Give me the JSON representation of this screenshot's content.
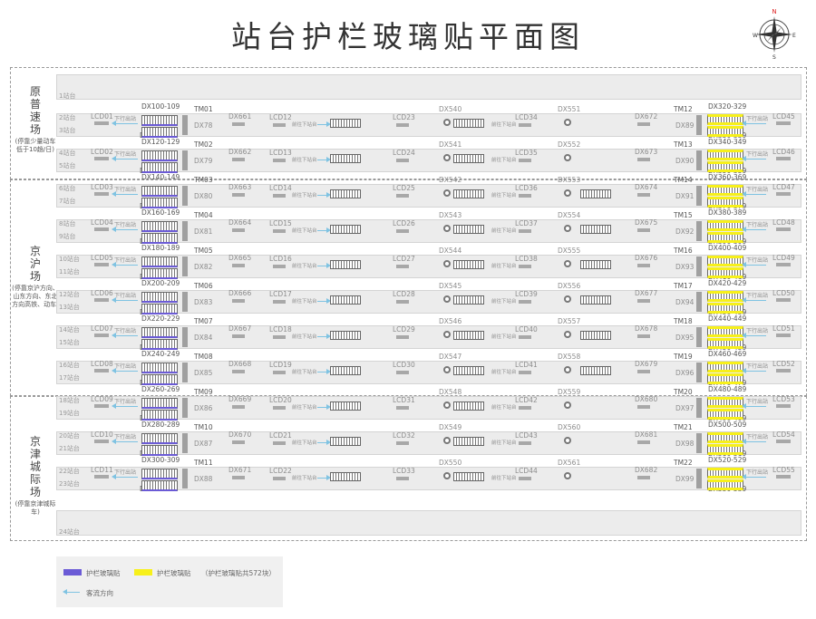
{
  "title": "站台护栏玻璃贴平面图",
  "compass_label": "N",
  "zones": [
    {
      "name": "原普速场",
      "note": "(停靠少量动车低于10趟/日)"
    },
    {
      "name": "京沪场",
      "note": "(停靠京沪方向、山东方向、东北方向高铁、动车)"
    },
    {
      "name": "京津城际场",
      "note": "(停靠京津城际车)"
    }
  ],
  "stations": [
    {
      "top": "1站台",
      "bottom": ""
    },
    {
      "top": "2站台",
      "bottom": "3站台",
      "left_dx_top": "DX100-109",
      "left_dx_bottom": "DX110-119",
      "tm_left": "TM01",
      "dx_l": "DX78",
      "dx_ml": "DX661",
      "lcd_l": "LCD01",
      "lcd_ml": "LCD12",
      "lcd_c": "LCD23",
      "dx_c": "DX540",
      "lcd_cr": "LCD34",
      "dx_cr": "DX551",
      "dx_mr": "DX672",
      "tm_right": "TM12",
      "dx_r": "DX89",
      "right_dx_top": "DX320-329",
      "right_dx_bottom": "DX330-339",
      "lcd_r": "LCD45"
    },
    {
      "top": "4站台",
      "bottom": "5站台",
      "left_dx_top": "DX120-129",
      "left_dx_bottom": "DX130-139",
      "tm_left": "TM02",
      "dx_l": "DX79",
      "dx_ml": "DX662",
      "lcd_l": "LCD02",
      "lcd_ml": "LCD13",
      "lcd_c": "LCD24",
      "dx_c": "DX541",
      "lcd_cr": "LCD35",
      "dx_cr": "DX552",
      "dx_mr": "DX673",
      "tm_right": "TM13",
      "dx_r": "DX90",
      "right_dx_top": "DX340-349",
      "right_dx_bottom": "DX350-359",
      "lcd_r": "LCD46"
    },
    {
      "top": "6站台",
      "bottom": "7站台",
      "left_dx_top": "DX140-149",
      "left_dx_bottom": "DX150-159",
      "tm_left": "TM03",
      "dx_l": "DX80",
      "dx_ml": "DX663",
      "lcd_l": "LCD03",
      "lcd_ml": "LCD14",
      "lcd_c": "LCD25",
      "dx_c": "DX542",
      "lcd_cr": "LCD36",
      "dx_cr": "DX553",
      "dx_mr": "DX674",
      "tm_right": "TM14",
      "dx_r": "DX91",
      "right_dx_top": "DX360-369",
      "right_dx_bottom": "DX370-379",
      "lcd_r": "LCD47"
    },
    {
      "top": "8站台",
      "bottom": "9站台",
      "left_dx_top": "DX160-169",
      "left_dx_bottom": "DX170-179",
      "tm_left": "TM04",
      "dx_l": "DX81",
      "dx_ml": "DX664",
      "lcd_l": "LCD04",
      "lcd_ml": "LCD15",
      "lcd_c": "LCD26",
      "dx_c": "DX543",
      "lcd_cr": "LCD37",
      "dx_cr": "DX554",
      "dx_mr": "DX675",
      "tm_right": "TM15",
      "dx_r": "DX92",
      "right_dx_top": "DX380-389",
      "right_dx_bottom": "DX390-399",
      "lcd_r": "LCD48"
    },
    {
      "top": "10站台",
      "bottom": "11站台",
      "left_dx_top": "DX180-189",
      "left_dx_bottom": "DX190-199",
      "tm_left": "TM05",
      "dx_l": "DX82",
      "dx_ml": "DX665",
      "lcd_l": "LCD05",
      "lcd_ml": "LCD16",
      "lcd_c": "LCD27",
      "dx_c": "DX544",
      "lcd_cr": "LCD38",
      "dx_cr": "DX555",
      "dx_mr": "DX676",
      "tm_right": "TM16",
      "dx_r": "DX93",
      "right_dx_top": "DX400-409",
      "right_dx_bottom": "DX410-419",
      "lcd_r": "LCD49"
    },
    {
      "top": "12站台",
      "bottom": "13站台",
      "left_dx_top": "DX200-209",
      "left_dx_bottom": "DX210-219",
      "tm_left": "TM06",
      "dx_l": "DX83",
      "dx_ml": "DX666",
      "lcd_l": "LCD06",
      "lcd_ml": "LCD17",
      "lcd_c": "LCD28",
      "dx_c": "DX545",
      "lcd_cr": "LCD39",
      "dx_cr": "DX556",
      "dx_mr": "DX677",
      "tm_right": "TM17",
      "dx_r": "DX94",
      "right_dx_top": "DX420-429",
      "right_dx_bottom": "DX430-439",
      "lcd_r": "LCD50"
    },
    {
      "top": "14站台",
      "bottom": "15站台",
      "left_dx_top": "DX220-229",
      "left_dx_bottom": "DX230-239",
      "tm_left": "TM07",
      "dx_l": "DX84",
      "dx_ml": "DX667",
      "lcd_l": "LCD07",
      "lcd_ml": "LCD18",
      "lcd_c": "LCD29",
      "dx_c": "DX546",
      "lcd_cr": "LCD40",
      "dx_cr": "DX557",
      "dx_mr": "DX678",
      "tm_right": "TM18",
      "dx_r": "DX95",
      "right_dx_top": "DX440-449",
      "right_dx_bottom": "DX450-459",
      "lcd_r": "LCD51"
    },
    {
      "top": "16站台",
      "bottom": "17站台",
      "left_dx_top": "DX240-249",
      "left_dx_bottom": "DX250-259",
      "tm_left": "TM08",
      "dx_l": "DX85",
      "dx_ml": "DX668",
      "lcd_l": "LCD08",
      "lcd_ml": "LCD19",
      "lcd_c": "LCD30",
      "dx_c": "DX547",
      "lcd_cr": "LCD41",
      "dx_cr": "DX558",
      "dx_mr": "DX679",
      "tm_right": "TM19",
      "dx_r": "DX96",
      "right_dx_top": "DX460-469",
      "right_dx_bottom": "DX470-479",
      "lcd_r": "LCD52"
    },
    {
      "top": "18站台",
      "bottom": "19站台",
      "left_dx_top": "DX260-269",
      "left_dx_bottom": "DX270-279",
      "tm_left": "TM09",
      "dx_l": "DX86",
      "dx_ml": "DX669",
      "lcd_l": "LCD09",
      "lcd_ml": "LCD20",
      "lcd_c": "LCD31",
      "dx_c": "DX548",
      "lcd_cr": "LCD42",
      "dx_cr": "DX559",
      "dx_mr": "DX680",
      "tm_right": "TM20",
      "dx_r": "DX97",
      "right_dx_top": "DX480-489",
      "right_dx_bottom": "DX490-499",
      "lcd_r": "LCD53"
    },
    {
      "top": "20站台",
      "bottom": "21站台",
      "left_dx_top": "DX280-289",
      "left_dx_bottom": "DX290-299",
      "tm_left": "TM10",
      "dx_l": "DX87",
      "dx_ml": "DX670",
      "lcd_l": "LCD10",
      "lcd_ml": "LCD21",
      "lcd_c": "LCD32",
      "dx_c": "DX549",
      "lcd_cr": "LCD43",
      "dx_cr": "DX560",
      "dx_mr": "DX681",
      "tm_right": "TM21",
      "dx_r": "DX98",
      "right_dx_top": "DX500-509",
      "right_dx_bottom": "DX510-519",
      "lcd_r": "LCD54"
    },
    {
      "top": "22站台",
      "bottom": "23站台",
      "left_dx_top": "DX300-309",
      "left_dx_bottom": "DX310-319",
      "tm_left": "TM11",
      "dx_l": "DX88",
      "dx_ml": "DX671",
      "lcd_l": "LCD11",
      "lcd_ml": "LCD22",
      "lcd_c": "LCD33",
      "dx_c": "DX550",
      "lcd_cr": "LCD44",
      "dx_cr": "DX561",
      "dx_mr": "DX682",
      "tm_right": "TM22",
      "dx_r": "DX99",
      "right_dx_top": "DX520-529",
      "right_dx_bottom": "DX530-539",
      "lcd_r": "LCD55"
    },
    {
      "top": "24站台",
      "bottom": ""
    }
  ],
  "labels": {
    "down_exit": "下行出站",
    "transfer": "前往下站台"
  },
  "legend": {
    "blue_label": "护栏玻璃贴",
    "yellow_label": "护栏玻璃贴",
    "yellow_note": "（护栏玻璃贴共572块）",
    "flow_label": "客流方向",
    "blue_color": "#6b5bd6",
    "yellow_color": "#f7f01a",
    "flow_color": "#7fc3e2"
  }
}
